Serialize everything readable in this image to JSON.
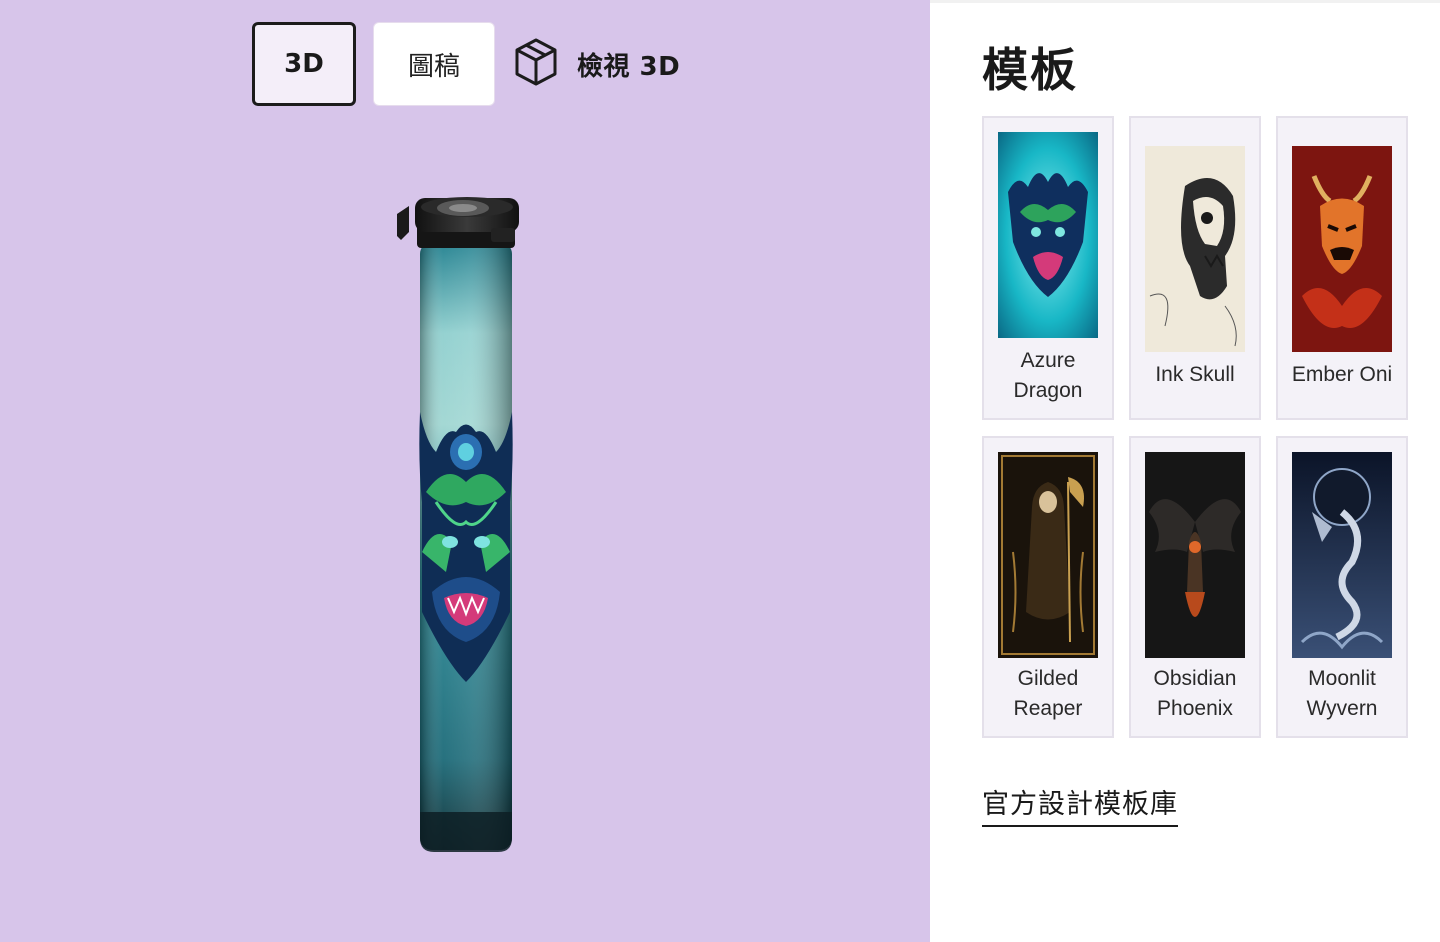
{
  "viewer": {
    "tabs": [
      {
        "label": "3D",
        "active": true
      },
      {
        "label": "圖稿",
        "active": false
      }
    ],
    "view_3d": {
      "label": "檢視 3D",
      "icon": "cube-icon"
    },
    "background": "#d7c5ea",
    "product": {
      "design": "Azure Dragon"
    }
  },
  "panel": {
    "title": "模板",
    "templates": [
      {
        "name": "Azure Dragon",
        "lines": [
          "Azure",
          "Dragon"
        ]
      },
      {
        "name": "Ink Skull",
        "lines": [
          "Ink Skull"
        ]
      },
      {
        "name": "Ember Oni",
        "lines": [
          "Ember Oni"
        ]
      },
      {
        "name": "Gilded Reaper",
        "lines": [
          "Gilded",
          "Reaper"
        ]
      },
      {
        "name": "Obsidian Phoenix",
        "lines": [
          "Obsidian",
          "Phoenix"
        ]
      },
      {
        "name": "Moonlit Wyvern",
        "lines": [
          "Moonlit",
          "Wyvern"
        ]
      }
    ],
    "library_link": "官方設計模板庫"
  }
}
